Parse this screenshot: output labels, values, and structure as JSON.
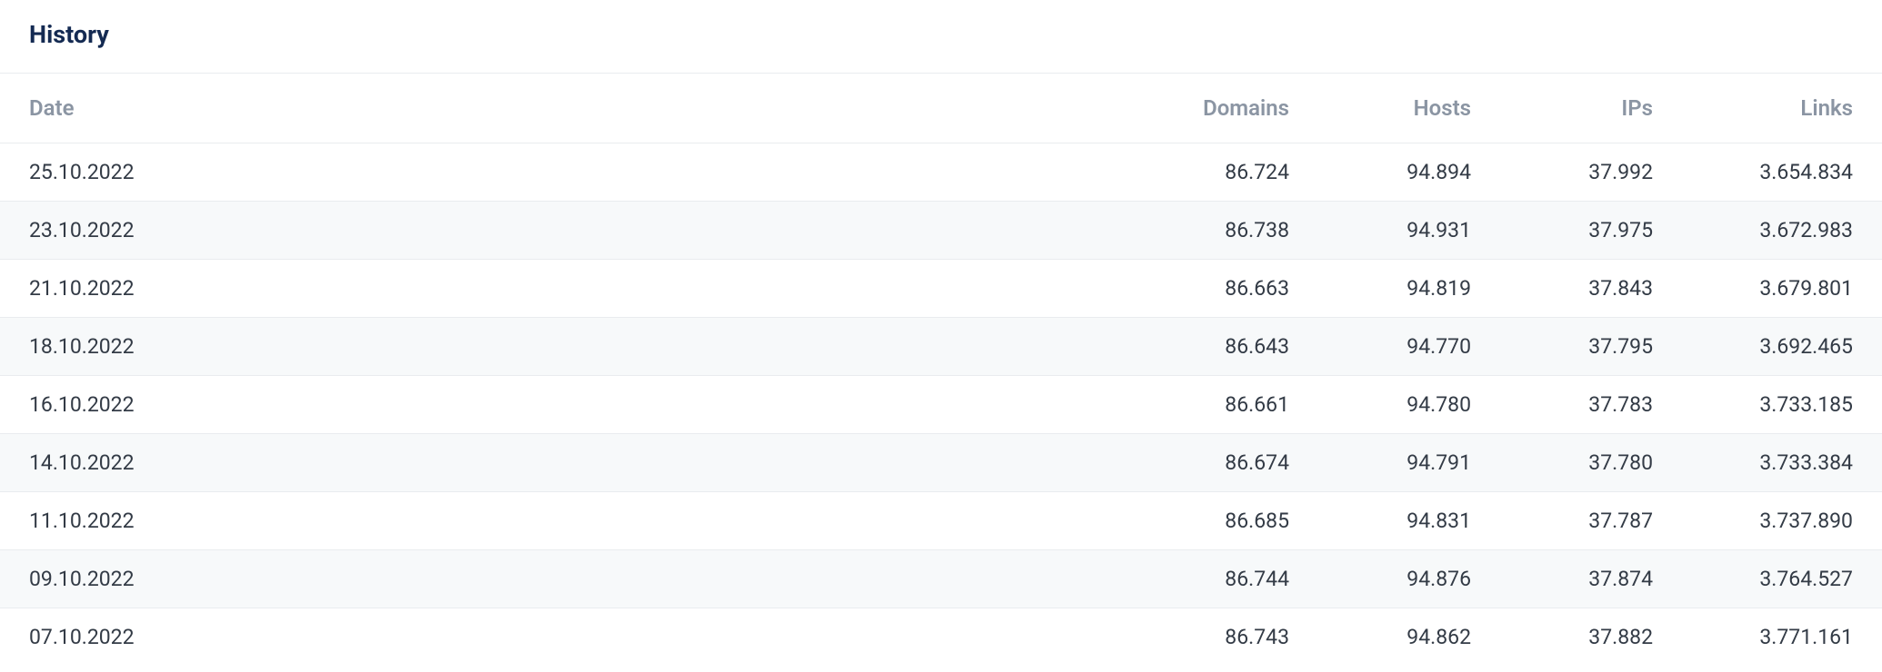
{
  "panel": {
    "title": "History"
  },
  "table": {
    "headers": {
      "date": "Date",
      "domains": "Domains",
      "hosts": "Hosts",
      "ips": "IPs",
      "links": "Links"
    },
    "rows": [
      {
        "date": "25.10.2022",
        "domains": "86.724",
        "hosts": "94.894",
        "ips": "37.992",
        "links": "3.654.834"
      },
      {
        "date": "23.10.2022",
        "domains": "86.738",
        "hosts": "94.931",
        "ips": "37.975",
        "links": "3.672.983"
      },
      {
        "date": "21.10.2022",
        "domains": "86.663",
        "hosts": "94.819",
        "ips": "37.843",
        "links": "3.679.801"
      },
      {
        "date": "18.10.2022",
        "domains": "86.643",
        "hosts": "94.770",
        "ips": "37.795",
        "links": "3.692.465"
      },
      {
        "date": "16.10.2022",
        "domains": "86.661",
        "hosts": "94.780",
        "ips": "37.783",
        "links": "3.733.185"
      },
      {
        "date": "14.10.2022",
        "domains": "86.674",
        "hosts": "94.791",
        "ips": "37.780",
        "links": "3.733.384"
      },
      {
        "date": "11.10.2022",
        "domains": "86.685",
        "hosts": "94.831",
        "ips": "37.787",
        "links": "3.737.890"
      },
      {
        "date": "09.10.2022",
        "domains": "86.744",
        "hosts": "94.876",
        "ips": "37.874",
        "links": "3.764.527"
      },
      {
        "date": "07.10.2022",
        "domains": "86.743",
        "hosts": "94.862",
        "ips": "37.882",
        "links": "3.771.161"
      }
    ]
  }
}
